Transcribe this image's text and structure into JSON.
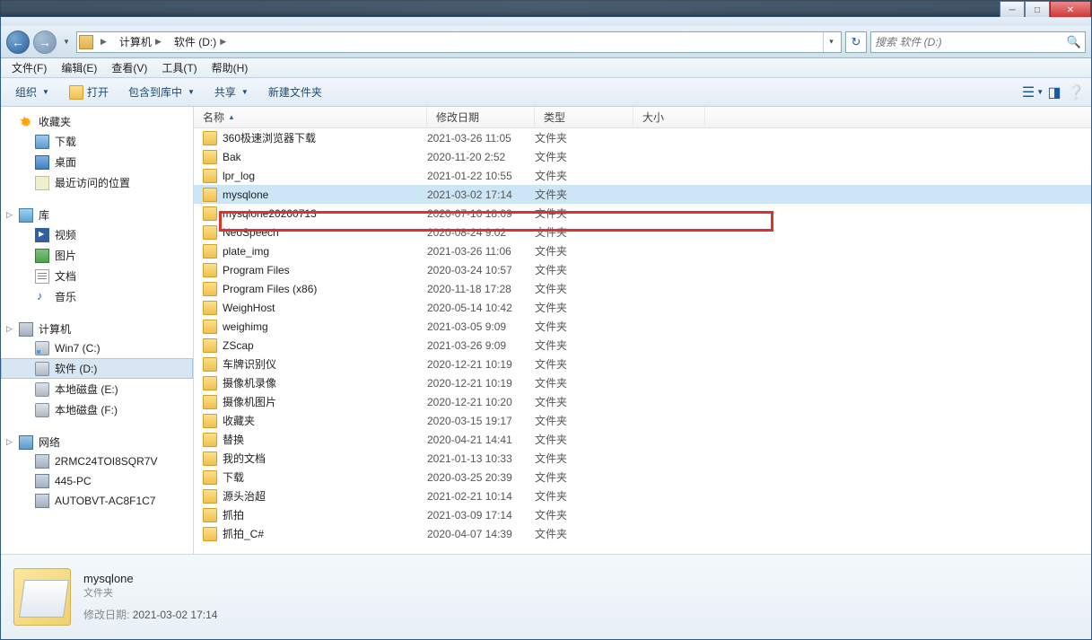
{
  "window": {
    "min": "─",
    "max": "□",
    "close": "✕"
  },
  "nav": {
    "back_glyph": "←",
    "fwd_glyph": "→",
    "breadcrumbs": [
      "计算机",
      "软件 (D:)"
    ],
    "refresh_glyph": "↻"
  },
  "search": {
    "placeholder": "搜索 软件 (D:)"
  },
  "menubar": [
    {
      "label": "文件(F)"
    },
    {
      "label": "编辑(E)"
    },
    {
      "label": "查看(V)"
    },
    {
      "label": "工具(T)"
    },
    {
      "label": "帮助(H)"
    }
  ],
  "toolbar": {
    "organize": "组织",
    "open": "打开",
    "include": "包含到库中",
    "share": "共享",
    "newfolder": "新建文件夹"
  },
  "sidebar": {
    "favorites": {
      "label": "收藏夹",
      "items": [
        {
          "label": "下载",
          "icon": "ic-folder-blue"
        },
        {
          "label": "桌面",
          "icon": "ic-desktop"
        },
        {
          "label": "最近访问的位置",
          "icon": "ic-recent"
        }
      ]
    },
    "libraries": {
      "label": "库",
      "items": [
        {
          "label": "视频",
          "icon": "ic-video"
        },
        {
          "label": "图片",
          "icon": "ic-pic"
        },
        {
          "label": "文档",
          "icon": "ic-doc"
        },
        {
          "label": "音乐",
          "icon": "ic-music"
        }
      ]
    },
    "computer": {
      "label": "计算机",
      "items": [
        {
          "label": "Win7 (C:)",
          "icon": "ic-drive ic-drive-c"
        },
        {
          "label": "软件 (D:)",
          "icon": "ic-drive",
          "selected": true
        },
        {
          "label": "本地磁盘 (E:)",
          "icon": "ic-drive"
        },
        {
          "label": "本地磁盘 (F:)",
          "icon": "ic-drive"
        }
      ]
    },
    "network": {
      "label": "网络",
      "items": [
        {
          "label": "2RMC24TOI8SQR7V",
          "icon": "ic-netpc"
        },
        {
          "label": "445-PC",
          "icon": "ic-netpc"
        },
        {
          "label": "AUTOBVT-AC8F1C7",
          "icon": "ic-netpc"
        }
      ]
    }
  },
  "columns": {
    "name": "名称",
    "date": "修改日期",
    "type": "类型",
    "size": "大小"
  },
  "files": [
    {
      "name": "360极速浏览器下载",
      "date": "2021-03-26 11:05",
      "type": "文件夹"
    },
    {
      "name": "Bak",
      "date": "2020-11-20 2:52",
      "type": "文件夹"
    },
    {
      "name": "lpr_log",
      "date": "2021-01-22 10:55",
      "type": "文件夹"
    },
    {
      "name": "mysqlone",
      "date": "2021-03-02 17:14",
      "type": "文件夹",
      "selected": true
    },
    {
      "name": "mysqlone20200713",
      "date": "2020-07-10 18:09",
      "type": "文件夹"
    },
    {
      "name": "NeoSpeech",
      "date": "2020-08-24 9:02",
      "type": "文件夹"
    },
    {
      "name": "plate_img",
      "date": "2021-03-26 11:06",
      "type": "文件夹"
    },
    {
      "name": "Program Files",
      "date": "2020-03-24 10:57",
      "type": "文件夹"
    },
    {
      "name": "Program Files (x86)",
      "date": "2020-11-18 17:28",
      "type": "文件夹"
    },
    {
      "name": "WeighHost",
      "date": "2020-05-14 10:42",
      "type": "文件夹"
    },
    {
      "name": "weighimg",
      "date": "2021-03-05 9:09",
      "type": "文件夹"
    },
    {
      "name": "ZScap",
      "date": "2021-03-26 9:09",
      "type": "文件夹"
    },
    {
      "name": "车牌识别仪",
      "date": "2020-12-21 10:19",
      "type": "文件夹"
    },
    {
      "name": "摄像机录像",
      "date": "2020-12-21 10:19",
      "type": "文件夹"
    },
    {
      "name": "摄像机图片",
      "date": "2020-12-21 10:20",
      "type": "文件夹"
    },
    {
      "name": "收藏夹",
      "date": "2020-03-15 19:17",
      "type": "文件夹"
    },
    {
      "name": "替换",
      "date": "2020-04-21 14:41",
      "type": "文件夹"
    },
    {
      "name": "我的文档",
      "date": "2021-01-13 10:33",
      "type": "文件夹"
    },
    {
      "name": "下载",
      "date": "2020-03-25 20:39",
      "type": "文件夹"
    },
    {
      "name": "源头治超",
      "date": "2021-02-21 10:14",
      "type": "文件夹"
    },
    {
      "name": "抓拍",
      "date": "2021-03-09 17:14",
      "type": "文件夹"
    },
    {
      "name": "抓拍_C#",
      "date": "2020-04-07 14:39",
      "type": "文件夹"
    }
  ],
  "details": {
    "name": "mysqlone",
    "type": "文件夹",
    "modlabel": "修改日期:",
    "moddate": "2021-03-02 17:14"
  }
}
